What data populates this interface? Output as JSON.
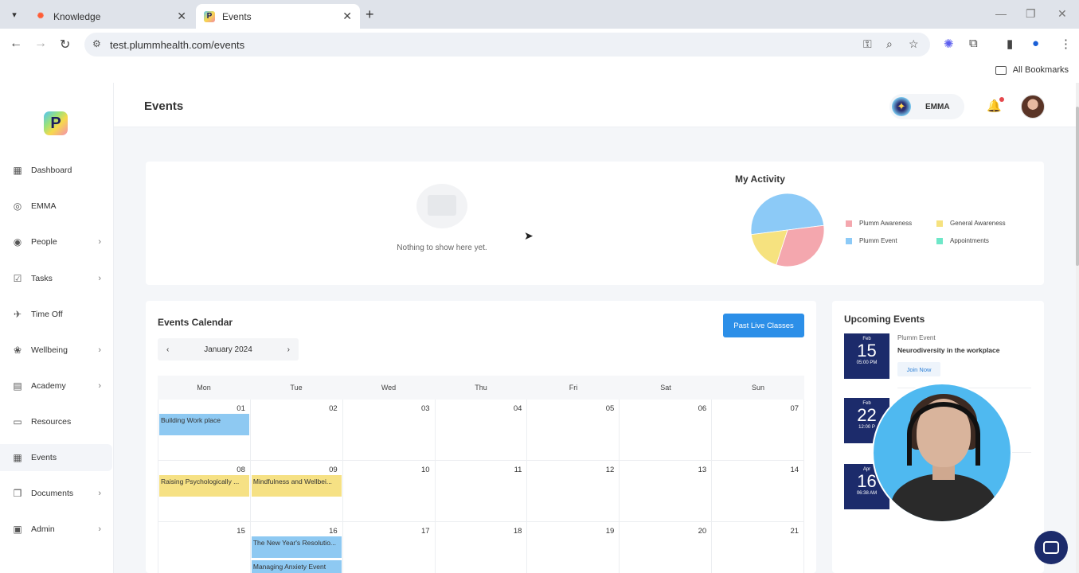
{
  "browser": {
    "tabs": [
      {
        "title": "Knowledge"
      },
      {
        "title": "Events"
      }
    ],
    "url": "test.plummhealth.com/events",
    "bookmarks_label": "All Bookmarks"
  },
  "sidebar": {
    "logo_letter": "P",
    "items": [
      {
        "label": "Dashboard",
        "icon": "grid-icon"
      },
      {
        "label": "EMMA",
        "icon": "chat-icon"
      },
      {
        "label": "People",
        "icon": "people-icon"
      },
      {
        "label": "Tasks",
        "icon": "tasks-icon"
      },
      {
        "label": "Time Off",
        "icon": "plane-icon"
      },
      {
        "label": "Wellbeing",
        "icon": "wellbeing-icon"
      },
      {
        "label": "Academy",
        "icon": "book-icon"
      },
      {
        "label": "Resources",
        "icon": "folder-icon"
      },
      {
        "label": "Events",
        "icon": "calendar-icon"
      },
      {
        "label": "Documents",
        "icon": "document-icon"
      },
      {
        "label": "Admin",
        "icon": "admin-icon"
      }
    ]
  },
  "header": {
    "title": "Events",
    "assistant_label": "EMMA"
  },
  "activity": {
    "empty_text": "Nothing to show here yet.",
    "title": "My Activity",
    "legend": [
      {
        "label": "Plumm Awareness",
        "color": "#f4a7ae"
      },
      {
        "label": "General Awareness",
        "color": "#f6e27f"
      },
      {
        "label": "Plumm Event",
        "color": "#8ccaf7"
      },
      {
        "label": "Appointments",
        "color": "#6ee7c8"
      }
    ]
  },
  "chart_data": {
    "type": "pie",
    "title": "My Activity",
    "categories": [
      "Plumm Event",
      "Plumm Awareness",
      "General Awareness",
      "Appointments"
    ],
    "values": [
      50,
      32,
      18,
      0
    ],
    "colors": [
      "#8ccaf7",
      "#f4a7ae",
      "#f6e27f",
      "#6ee7c8"
    ]
  },
  "calendar": {
    "title": "Events Calendar",
    "past_button": "Past Live Classes",
    "month": "January 2024",
    "weekdays": [
      "Mon",
      "Tue",
      "Wed",
      "Thu",
      "Fri",
      "Sat",
      "Sun"
    ],
    "weeks": [
      {
        "days": [
          "01",
          "02",
          "03",
          "04",
          "05",
          "06",
          "07"
        ]
      },
      {
        "days": [
          "08",
          "09",
          "10",
          "11",
          "12",
          "13",
          "14"
        ]
      },
      {
        "days": [
          "15",
          "16",
          "17",
          "18",
          "19",
          "20",
          "21"
        ]
      }
    ],
    "events": [
      {
        "label": "Building Work place"
      },
      {
        "label": "Raising Psychologically ..."
      },
      {
        "label": "Mindfulness and Wellbei..."
      },
      {
        "label": "The New Year's Resolutio..."
      },
      {
        "label": "Managing Anxiety Event"
      }
    ]
  },
  "upcoming": {
    "title": "Upcoming Events",
    "events": [
      {
        "month": "Feb",
        "day": "15",
        "time": "05:00 PM",
        "type": "Plumm Event",
        "name": "Neurodiversity in the workplace",
        "action": "Join Now"
      },
      {
        "month": "Feb",
        "day": "22",
        "time": "12:00 P"
      },
      {
        "month": "Apr",
        "day": "16",
        "time": "06:38 AM"
      }
    ]
  }
}
